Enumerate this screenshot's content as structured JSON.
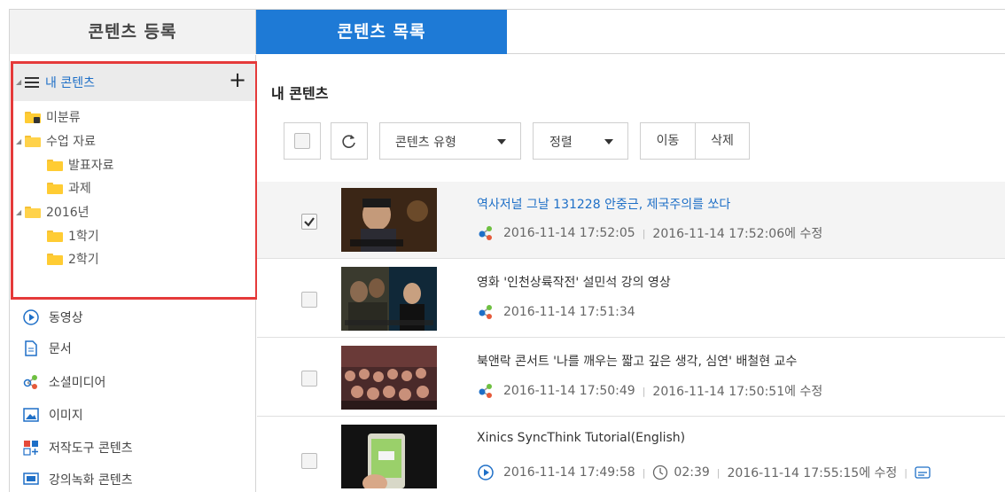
{
  "tabs": {
    "register": "콘텐츠 등록",
    "list": "콘텐츠 목록"
  },
  "tree": {
    "title": "내 콘텐츠",
    "add": "+",
    "nodes": [
      "미분류",
      "수업 자료",
      "발표자료",
      "과제",
      "2016년",
      "1학기",
      "2학기"
    ]
  },
  "media": [
    "동영상",
    "문서",
    "소셜미디어",
    "이미지",
    "저작도구 콘텐츠",
    "강의녹화 콘텐츠"
  ],
  "main": {
    "title": "내 콘텐츠",
    "type_label": "콘텐츠 유형",
    "sort_label": "정렬",
    "move_label": "이동",
    "delete_label": "삭제"
  },
  "rows": [
    {
      "title": "역사저널 그날 131228 안중근, 제국주의를 쏘다",
      "created": "2016-11-14 17:52:05",
      "modified": "2016-11-14 17:52:06에 수정",
      "checked": true
    },
    {
      "title": "영화 '인천상륙작전' 설민석 강의 영상",
      "created": "2016-11-14 17:51:34",
      "modified": "",
      "checked": false
    },
    {
      "title": "북앤락 콘서트 '나를 깨우는 짧고 깊은 생각, 심연' 배철현 교수",
      "created": "2016-11-14 17:50:49",
      "modified": "2016-11-14 17:50:51에 수정",
      "checked": false
    },
    {
      "title": "Xinics SyncThink Tutorial(English)",
      "created": "2016-11-14 17:49:58",
      "duration": "02:39",
      "modified": "2016-11-14 17:55:15에 수정",
      "checked": false
    }
  ],
  "colors": {
    "accent": "#1e7ad6",
    "highlight_border": "#e53a3a",
    "folder": "#ffcc33"
  }
}
